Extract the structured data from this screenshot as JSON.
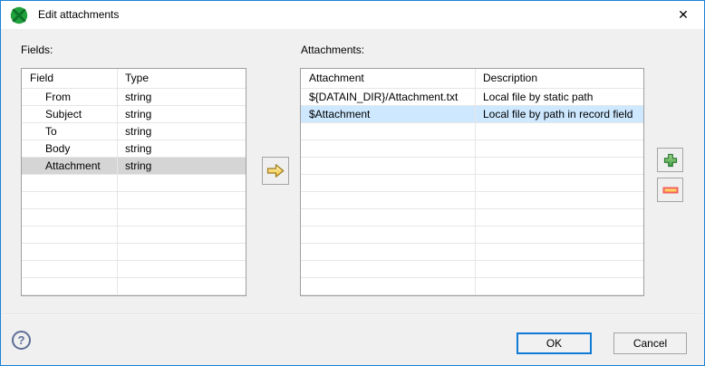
{
  "window": {
    "title": "Edit attachments",
    "close": "✕"
  },
  "fields": {
    "label": "Fields:",
    "columns": {
      "col1": "Field",
      "col2": "Type"
    },
    "rows": [
      {
        "field": "From",
        "type": "string"
      },
      {
        "field": "Subject",
        "type": "string"
      },
      {
        "field": "To",
        "type": "string"
      },
      {
        "field": "Body",
        "type": "string"
      },
      {
        "field": "Attachment",
        "type": "string"
      }
    ],
    "selected_row": "Attachment"
  },
  "attachments": {
    "label": "Attachments:",
    "columns": {
      "col1": "Attachment",
      "col2": "Description"
    },
    "rows": [
      {
        "attachment": "${DATAIN_DIR}/Attachment.txt",
        "description": "Local file by static path"
      },
      {
        "attachment": "$Attachment",
        "description": "Local file by path in record field"
      }
    ],
    "selected_row": "$Attachment"
  },
  "buttons": {
    "ok": "OK",
    "cancel": "Cancel",
    "help": "?"
  },
  "icons": {
    "app_icon": "green-circle-x-logo",
    "move_right_icon": "yellow-right-arrow",
    "add_icon": "green-plus",
    "remove_icon": "red-minus"
  },
  "colors": {
    "accent_border": "#1883d7",
    "selection_blue": "#cde8ff",
    "selection_gray": "#d5d5d5",
    "ok_border": "#0f7bd7"
  }
}
